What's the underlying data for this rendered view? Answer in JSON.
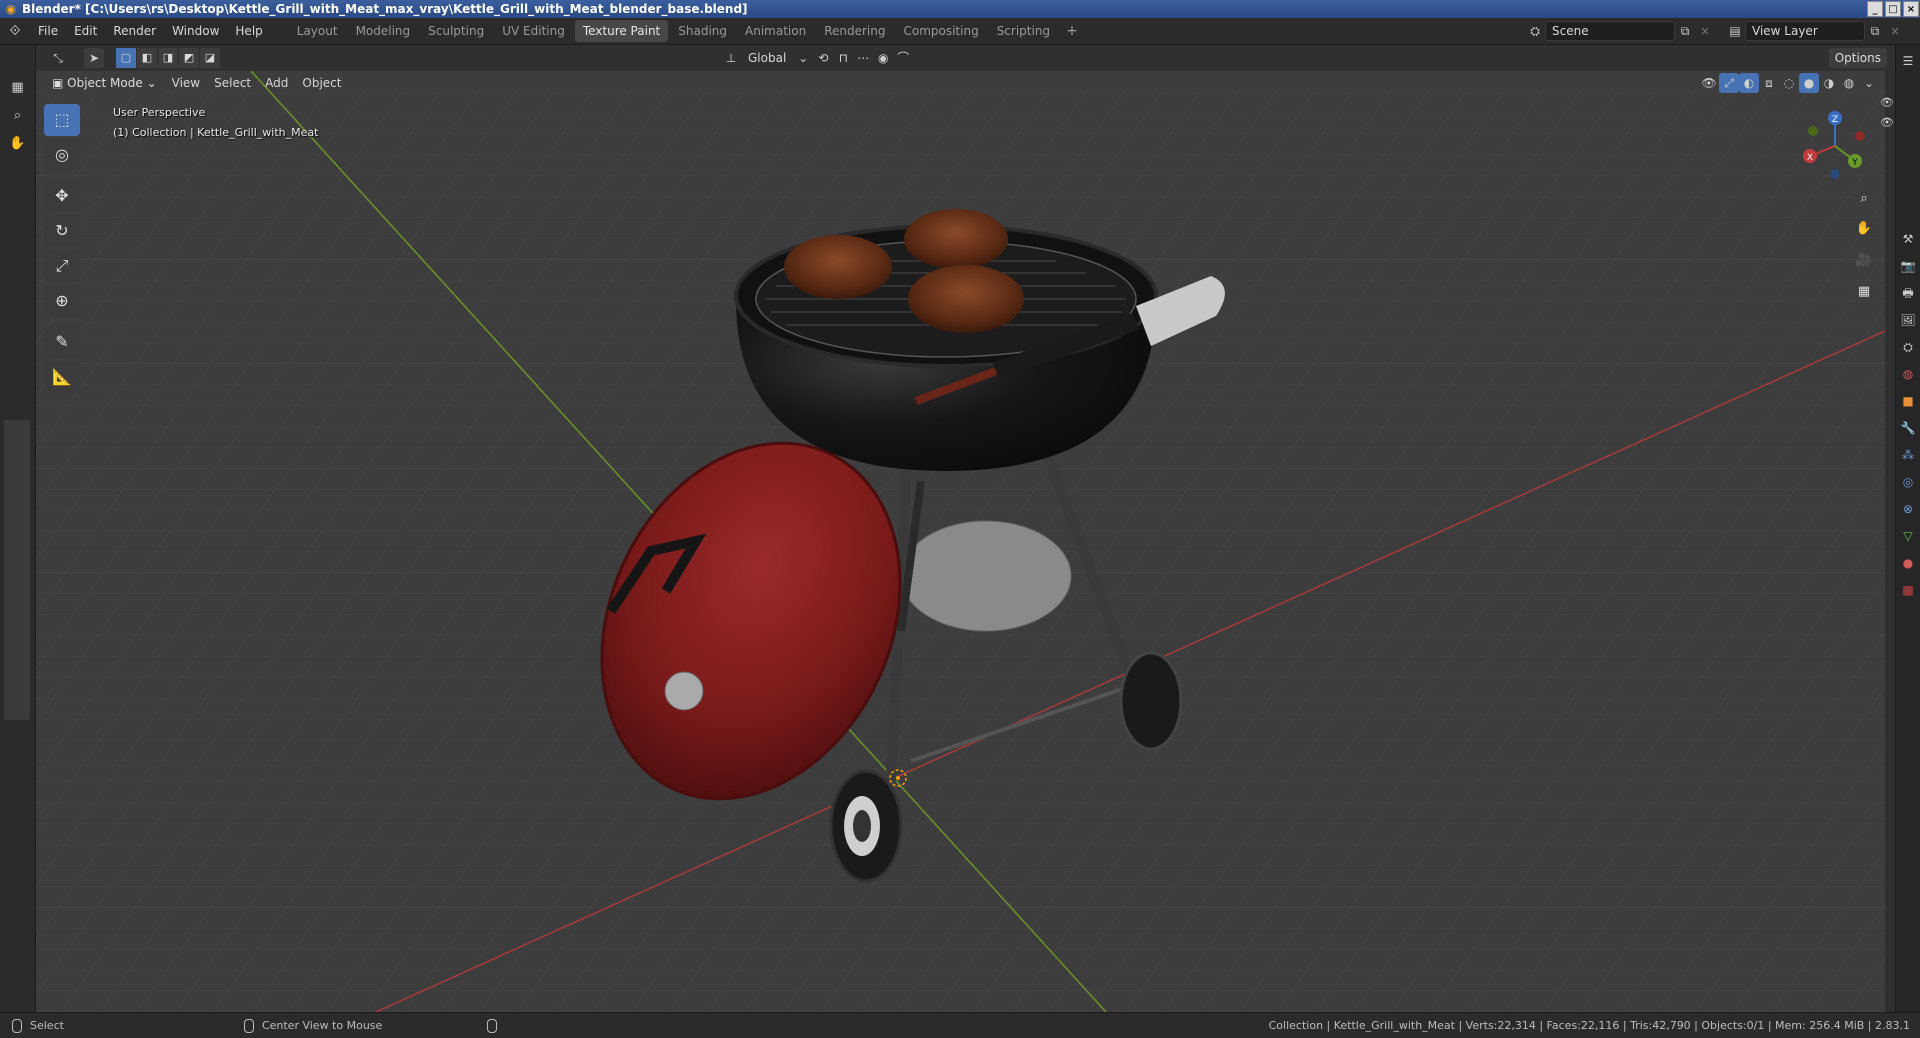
{
  "window": {
    "title": "Blender* [C:\\Users\\rs\\Desktop\\Kettle_Grill_with_Meat_max_vray\\Kettle_Grill_with_Meat_blender_base.blend]"
  },
  "menu": [
    "File",
    "Edit",
    "Render",
    "Window",
    "Help"
  ],
  "workspaces": {
    "tabs": [
      "Layout",
      "Modeling",
      "Sculpting",
      "UV Editing",
      "Texture Paint",
      "Shading",
      "Animation",
      "Rendering",
      "Compositing",
      "Scripting"
    ],
    "active": "Texture Paint",
    "add": "+"
  },
  "scene": {
    "name": "Scene",
    "view_layer": "View Layer"
  },
  "tool_header": {
    "orientation": "Global",
    "options": "Options"
  },
  "view_header": {
    "mode": "Object Mode",
    "menus": [
      "View",
      "Select",
      "Add",
      "Object"
    ]
  },
  "viewport": {
    "perspective": "User Perspective",
    "collection": "(1) Collection | Kettle_Grill_with_Meat",
    "gizmo_axes": {
      "x": "X",
      "y": "Y",
      "z": "Z"
    }
  },
  "toolbar": {
    "tools": [
      {
        "name": "select-box",
        "glyph": "⬚"
      },
      {
        "name": "cursor",
        "glyph": "◎"
      },
      {
        "name": "move",
        "glyph": "✥"
      },
      {
        "name": "rotate",
        "glyph": "↻"
      },
      {
        "name": "scale",
        "glyph": "⤢"
      },
      {
        "name": "transform",
        "glyph": "⊕"
      },
      {
        "name": "annotate",
        "glyph": "✎"
      },
      {
        "name": "measure",
        "glyph": "📐"
      }
    ]
  },
  "statusbar": {
    "left": "Select",
    "middle": "Center View to Mouse",
    "right": "Collection | Kettle_Grill_with_Meat | Verts:22,314 | Faces:22,116 | Tris:42,790 | Objects:0/1 | Mem: 256.4 MiB | 2.83.1"
  },
  "colors": {
    "accent": "#4772b3",
    "x_axis": "#a33b3b",
    "y_axis": "#6a8f2a",
    "grill_body": "#151515",
    "lid_red": "#7a1a1a"
  }
}
